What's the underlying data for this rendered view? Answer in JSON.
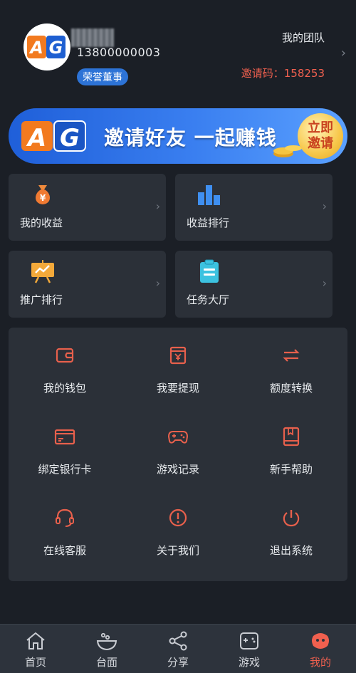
{
  "profile": {
    "phone": "13800000003",
    "rank_badge": "荣誉董事",
    "team_link": "我的团队",
    "invite_code": "邀请码：158253",
    "avatar_logo": "AG"
  },
  "banner": {
    "logo": "AG",
    "text": "邀请好友 一起赚钱",
    "button_line1": "立即",
    "button_line2": "邀请"
  },
  "tiles": [
    {
      "label": "我的收益",
      "icon": "money-bag-icon"
    },
    {
      "label": "收益排行",
      "icon": "bar-chart-icon"
    },
    {
      "label": "推广排行",
      "icon": "presentation-icon"
    },
    {
      "label": "任务大厅",
      "icon": "clipboard-icon"
    }
  ],
  "grid": [
    {
      "label": "我的钱包",
      "icon": "wallet-icon"
    },
    {
      "label": "我要提现",
      "icon": "withdraw-icon"
    },
    {
      "label": "额度转换",
      "icon": "transfer-arrows-icon"
    },
    {
      "label": "绑定银行卡",
      "icon": "bank-card-icon"
    },
    {
      "label": "游戏记录",
      "icon": "gamepad-icon"
    },
    {
      "label": "新手帮助",
      "icon": "book-icon"
    },
    {
      "label": "在线客服",
      "icon": "headset-icon"
    },
    {
      "label": "关于我们",
      "icon": "info-alert-icon"
    },
    {
      "label": "退出系统",
      "icon": "power-icon"
    }
  ],
  "nav": [
    {
      "label": "首页",
      "icon": "home-icon"
    },
    {
      "label": "台面",
      "icon": "bowl-icon"
    },
    {
      "label": "分享",
      "icon": "share-icon"
    },
    {
      "label": "游戏",
      "icon": "gamepad-icon"
    },
    {
      "label": "我的",
      "icon": "profile-face-icon",
      "active": true
    }
  ],
  "colors": {
    "accent": "#f0604f",
    "background": "#1b1f26",
    "card": "#2b3038",
    "badge": "#2d73d6"
  }
}
